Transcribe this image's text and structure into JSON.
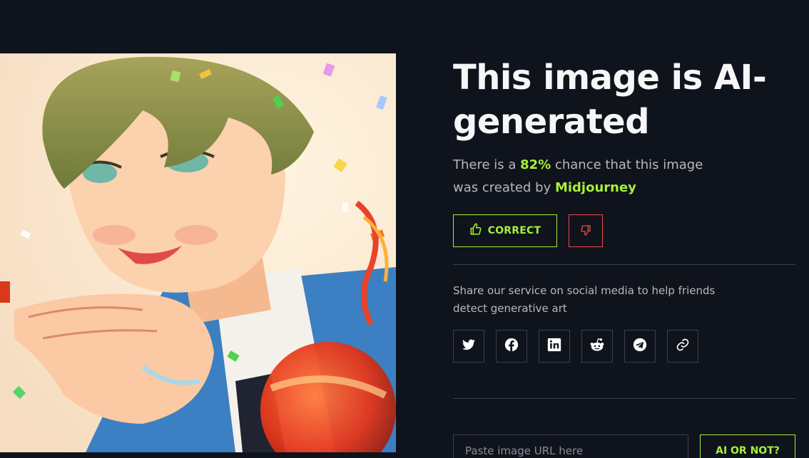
{
  "result": {
    "title": "This image is AI-generated",
    "chance_prefix": "There is a ",
    "chance_value": "82%",
    "chance_middle": " chance that this image was created by ",
    "model": "Midjourney"
  },
  "feedback": {
    "correct_label": "CORRECT",
    "correct_icon": "thumbs-up-icon",
    "wrong_icon": "thumbs-down-icon"
  },
  "share": {
    "text": "Share our service on social media to help friends detect generative art",
    "networks": [
      "twitter-icon",
      "facebook-icon",
      "linkedin-icon",
      "reddit-icon",
      "telegram-icon",
      "link-icon"
    ]
  },
  "url_form": {
    "placeholder": "Paste image URL here",
    "value": "",
    "submit_label": "AI OR NOT?"
  },
  "colors": {
    "background": "#0f131c",
    "accent": "#a6f03b",
    "danger": "#ef4949",
    "border": "#3b3f48"
  }
}
